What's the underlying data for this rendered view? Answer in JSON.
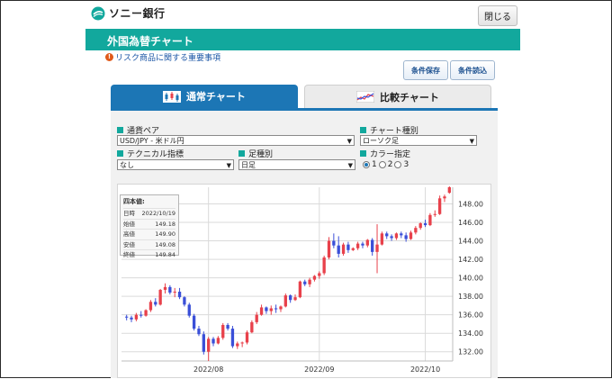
{
  "header": {
    "logo_text": "ソニー銀行",
    "close_label": "閉じる"
  },
  "page": {
    "title": "外国為替チャート",
    "risk_link": "リスク商品に関する重要事項",
    "save_label": "条件保存",
    "load_label": "条件読込"
  },
  "tabs": [
    {
      "label": "通常チャート",
      "active": true
    },
    {
      "label": "比較チャート",
      "active": false
    }
  ],
  "controls": {
    "pair": {
      "label": "通貨ペア",
      "value": "USD/JPY - 米ドル円"
    },
    "chart_type": {
      "label": "チャート種別",
      "value": "ローソク足"
    },
    "technical": {
      "label": "テクニカル指標",
      "value": "なし"
    },
    "interval": {
      "label": "足種別",
      "value": "日足"
    },
    "color": {
      "label": "カラー指定",
      "options": [
        "1",
        "2",
        "3"
      ],
      "selected": "1"
    }
  },
  "tooltip": {
    "title": "四本値:",
    "rows": [
      {
        "k": "日時",
        "v": "2022/10/19"
      },
      {
        "k": "始値",
        "v": "149.18"
      },
      {
        "k": "高値",
        "v": "149.90"
      },
      {
        "k": "安値",
        "v": "149.08"
      },
      {
        "k": "終値",
        "v": "149.84"
      }
    ]
  },
  "colors": {
    "up": "#e8414b",
    "down": "#3a4fd8",
    "accent": "#12a89d",
    "tab_blue": "#1c76b5"
  },
  "chart_data": {
    "type": "candlestick",
    "ylim": [
      131,
      149.8
    ],
    "y_ticks": [
      132,
      134,
      136,
      138,
      140,
      142,
      144,
      146,
      148
    ],
    "y_tick_labels": [
      "132.00",
      "134.00",
      "136.00",
      "138.00",
      "140.00",
      "142.00",
      "144.00",
      "146.00",
      "148.00"
    ],
    "x_ticks": [
      {
        "index": 17,
        "label": "2022/08"
      },
      {
        "index": 40,
        "label": "2022/09"
      },
      {
        "index": 62,
        "label": "2022/10"
      }
    ],
    "candles": [
      [
        135.8,
        136.0,
        135.4,
        135.7
      ],
      [
        135.7,
        135.9,
        135.2,
        135.5
      ],
      [
        135.5,
        136.2,
        135.3,
        136.0
      ],
      [
        136.0,
        136.4,
        135.7,
        135.9
      ],
      [
        135.9,
        136.6,
        135.8,
        136.5
      ],
      [
        136.5,
        137.6,
        136.3,
        137.4
      ],
      [
        137.4,
        137.8,
        136.9,
        137.1
      ],
      [
        137.1,
        138.8,
        137.0,
        138.7
      ],
      [
        138.7,
        139.4,
        138.3,
        139.0
      ],
      [
        139.0,
        139.2,
        138.2,
        138.4
      ],
      [
        138.4,
        138.9,
        137.9,
        138.5
      ],
      [
        138.5,
        138.9,
        137.7,
        137.9
      ],
      [
        137.9,
        138.0,
        136.9,
        137.1
      ],
      [
        137.1,
        137.3,
        135.7,
        135.9
      ],
      [
        135.9,
        136.1,
        134.3,
        134.5
      ],
      [
        134.5,
        134.8,
        133.7,
        133.9
      ],
      [
        133.9,
        134.2,
        131.7,
        132.0
      ],
      [
        132.0,
        133.6,
        131.0,
        133.4
      ],
      [
        133.4,
        133.6,
        132.6,
        132.9
      ],
      [
        132.9,
        133.7,
        132.8,
        133.5
      ],
      [
        133.5,
        135.1,
        133.3,
        134.9
      ],
      [
        134.9,
        135.1,
        134.3,
        134.5
      ],
      [
        134.5,
        134.8,
        132.4,
        132.6
      ],
      [
        132.6,
        133.1,
        132.3,
        132.9
      ],
      [
        132.9,
        133.1,
        132.5,
        133.0
      ],
      [
        133.0,
        134.3,
        132.8,
        134.1
      ],
      [
        134.1,
        135.4,
        134.0,
        135.2
      ],
      [
        135.2,
        136.3,
        135.0,
        136.0
      ],
      [
        136.0,
        137.1,
        135.9,
        136.8
      ],
      [
        136.8,
        136.9,
        136.1,
        136.4
      ],
      [
        136.4,
        137.0,
        136.0,
        136.7
      ],
      [
        136.7,
        137.1,
        136.2,
        136.6
      ],
      [
        136.6,
        137.0,
        136.3,
        136.9
      ],
      [
        136.9,
        138.3,
        136.8,
        138.1
      ],
      [
        138.1,
        138.2,
        137.3,
        137.6
      ],
      [
        137.6,
        138.2,
        137.5,
        137.9
      ],
      [
        137.9,
        139.7,
        137.8,
        139.6
      ],
      [
        139.6,
        139.8,
        139.1,
        139.3
      ],
      [
        139.3,
        140.0,
        139.0,
        139.8
      ],
      [
        139.8,
        140.3,
        139.6,
        140.2
      ],
      [
        140.2,
        140.7,
        139.9,
        140.5
      ],
      [
        140.5,
        142.4,
        140.3,
        142.2
      ],
      [
        142.2,
        144.4,
        142.0,
        144.0
      ],
      [
        144.0,
        144.8,
        143.2,
        143.5
      ],
      [
        143.5,
        144.5,
        142.2,
        142.6
      ],
      [
        142.6,
        143.8,
        142.4,
        143.6
      ],
      [
        143.6,
        143.9,
        142.7,
        143.0
      ],
      [
        143.0,
        143.3,
        142.9,
        143.2
      ],
      [
        143.2,
        143.9,
        143.0,
        143.7
      ],
      [
        143.7,
        143.9,
        143.2,
        143.5
      ],
      [
        143.5,
        144.2,
        143.3,
        144.1
      ],
      [
        144.1,
        144.3,
        142.4,
        142.8
      ],
      [
        142.8,
        145.8,
        140.5,
        143.6
      ],
      [
        143.6,
        145.0,
        143.5,
        144.8
      ],
      [
        144.8,
        145.0,
        144.2,
        144.5
      ],
      [
        144.5,
        144.7,
        144.0,
        144.3
      ],
      [
        144.3,
        144.9,
        144.1,
        144.8
      ],
      [
        144.8,
        145.0,
        144.3,
        144.6
      ],
      [
        144.6,
        144.9,
        143.9,
        144.2
      ],
      [
        144.2,
        145.1,
        144.1,
        144.9
      ],
      [
        144.9,
        145.6,
        144.7,
        145.4
      ],
      [
        145.4,
        146.0,
        145.2,
        145.9
      ],
      [
        145.9,
        146.3,
        145.5,
        145.7
      ],
      [
        145.7,
        147.0,
        145.6,
        146.8
      ],
      [
        146.8,
        147.3,
        146.6,
        146.9
      ],
      [
        146.9,
        148.9,
        146.8,
        148.6
      ],
      [
        148.6,
        149.0,
        148.2,
        148.8
      ],
      [
        149.2,
        149.9,
        149.1,
        149.8
      ]
    ]
  }
}
